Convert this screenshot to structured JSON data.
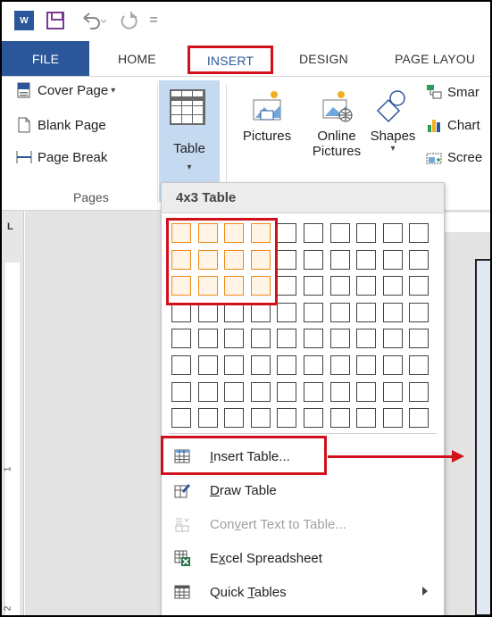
{
  "qat": {
    "app_logo_text": "W",
    "more_glyph": "="
  },
  "tabs": [
    {
      "label": "FILE"
    },
    {
      "label": "HOME"
    },
    {
      "label": "INSERT"
    },
    {
      "label": "DESIGN"
    },
    {
      "label": "PAGE LAYOU"
    }
  ],
  "ribbon": {
    "pages": {
      "cover_page": "Cover Page",
      "cover_page_caret": "▾",
      "blank_page": "Blank Page",
      "page_break": "Page Break",
      "group_label": "Pages"
    },
    "table": {
      "label": "Table",
      "caret": "▾"
    },
    "illustrations": {
      "pictures": "Pictures",
      "online_line1": "Online",
      "online_line2": "Pictures",
      "shapes": "Shapes",
      "shapes_caret": "▾",
      "smartart": "Smar",
      "chart": "Chart",
      "screenshot": "Scree"
    }
  },
  "ruler": {
    "corner": "L",
    "num1": "1",
    "num2": "2"
  },
  "table_menu": {
    "title": "4x3 Table",
    "grid": {
      "columns": 10,
      "rows": 8,
      "selected_columns": 4,
      "selected_rows": 3
    },
    "items": {
      "insert_table": {
        "hot": "I",
        "rest": "nsert Table..."
      },
      "draw_table": {
        "hot": "D",
        "rest": "raw Table"
      },
      "convert": {
        "pre": "Con",
        "hot": "v",
        "rest": "ert Text to Table..."
      },
      "excel": {
        "pre": "E",
        "hot": "x",
        "rest": "cel Spreadsheet"
      },
      "quick": {
        "pre": "Quick ",
        "hot": "T",
        "rest": "ables"
      }
    }
  },
  "colors": {
    "word_blue": "#2b579a",
    "highlight_red": "#d0111b",
    "grid_orange": "#ef8a17",
    "table_button_bg": "#c5d9f1"
  }
}
